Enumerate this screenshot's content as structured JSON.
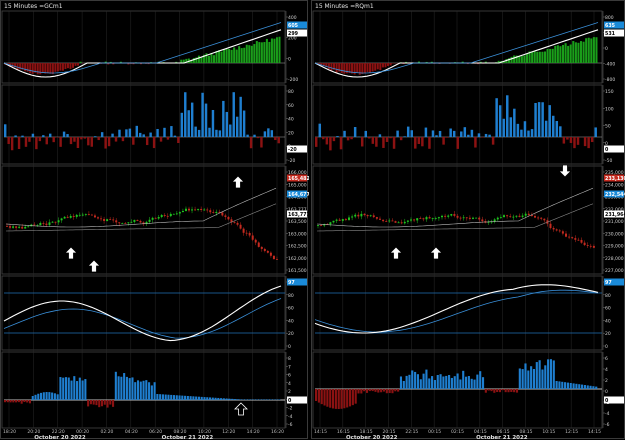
{
  "charts": [
    {
      "id": "left",
      "title": "15 Minutes =GCm1",
      "macd_axis": [
        "400",
        "200",
        "0",
        "-200"
      ],
      "macd_value_boxes": [
        "605",
        "299"
      ],
      "hist_axis": [
        "80",
        "60",
        "40",
        "20",
        "0",
        "-20"
      ],
      "hist_value_box": "-20",
      "price_axis": [
        "166,000",
        "165,000",
        "164,500",
        "163,777",
        "163,500",
        "163,000",
        "162,500",
        "162,000",
        "161,500"
      ],
      "price_value_boxes": [
        "165,482",
        "164,677",
        "163,777"
      ],
      "stoch_axis": [
        "100",
        "80",
        "60",
        "40",
        "20",
        "0"
      ],
      "stoch_value_box": "97",
      "lower_axis": [
        "8",
        "7",
        "6",
        "4",
        "2",
        "0",
        "-2",
        "-4",
        "-6"
      ],
      "lower_value_box": "0",
      "time_labels": [
        "18:20",
        "20:20",
        "22:20",
        "00:20",
        "02:20",
        "04:20",
        "06:20",
        "08:20",
        "10:20",
        "12:20",
        "14:20",
        "16:20"
      ],
      "date_labels": [
        "October 20 2022",
        "October 21 2022"
      ]
    },
    {
      "id": "right",
      "title": "15 Minutes =RQm1",
      "macd_axis": [
        "800",
        "400",
        "0",
        "-400",
        "-800"
      ],
      "macd_value_boxes": [
        "635",
        "531"
      ],
      "hist_axis": [
        "150",
        "100",
        "50",
        "0",
        "-50"
      ],
      "hist_value_box": "0",
      "price_axis": [
        "235,000",
        "234,000",
        "233,000",
        "232,000",
        "231,000",
        "230,000",
        "229,000",
        "228,000",
        "227,000"
      ],
      "price_value_boxes": [
        "233,130",
        "232,544",
        "231,964"
      ],
      "stoch_axis": [
        "100",
        "80",
        "60",
        "40",
        "20",
        "0"
      ],
      "stoch_value_box": "97",
      "lower_axis": [
        "6",
        "4",
        "2",
        "0",
        "-2",
        "-4",
        "-6"
      ],
      "lower_value_box": "0",
      "time_labels": [
        "14:15",
        "16:15",
        "18:15",
        "20:15",
        "22:15",
        "00:15",
        "02:15",
        "04:15",
        "06:15",
        "08:15",
        "10:15",
        "12:15",
        "14:15"
      ],
      "date_labels": [
        "October 20 2022",
        "October 21 2022"
      ]
    }
  ],
  "colors": {
    "background": "#000000",
    "up_candle": "#1fc41f",
    "down_candle": "#c42a1f",
    "hist_up": "#1f7fd0",
    "hist_down": "#8c1212",
    "macd_green": "#1a9e1a",
    "signal_line": "#ffffff",
    "blue_line": "#3a8fd8",
    "grid": "#2a2a2a"
  },
  "icons": [
    "arrow-up-icon",
    "arrow-down-icon",
    "arrow-up-outline-icon"
  ]
}
